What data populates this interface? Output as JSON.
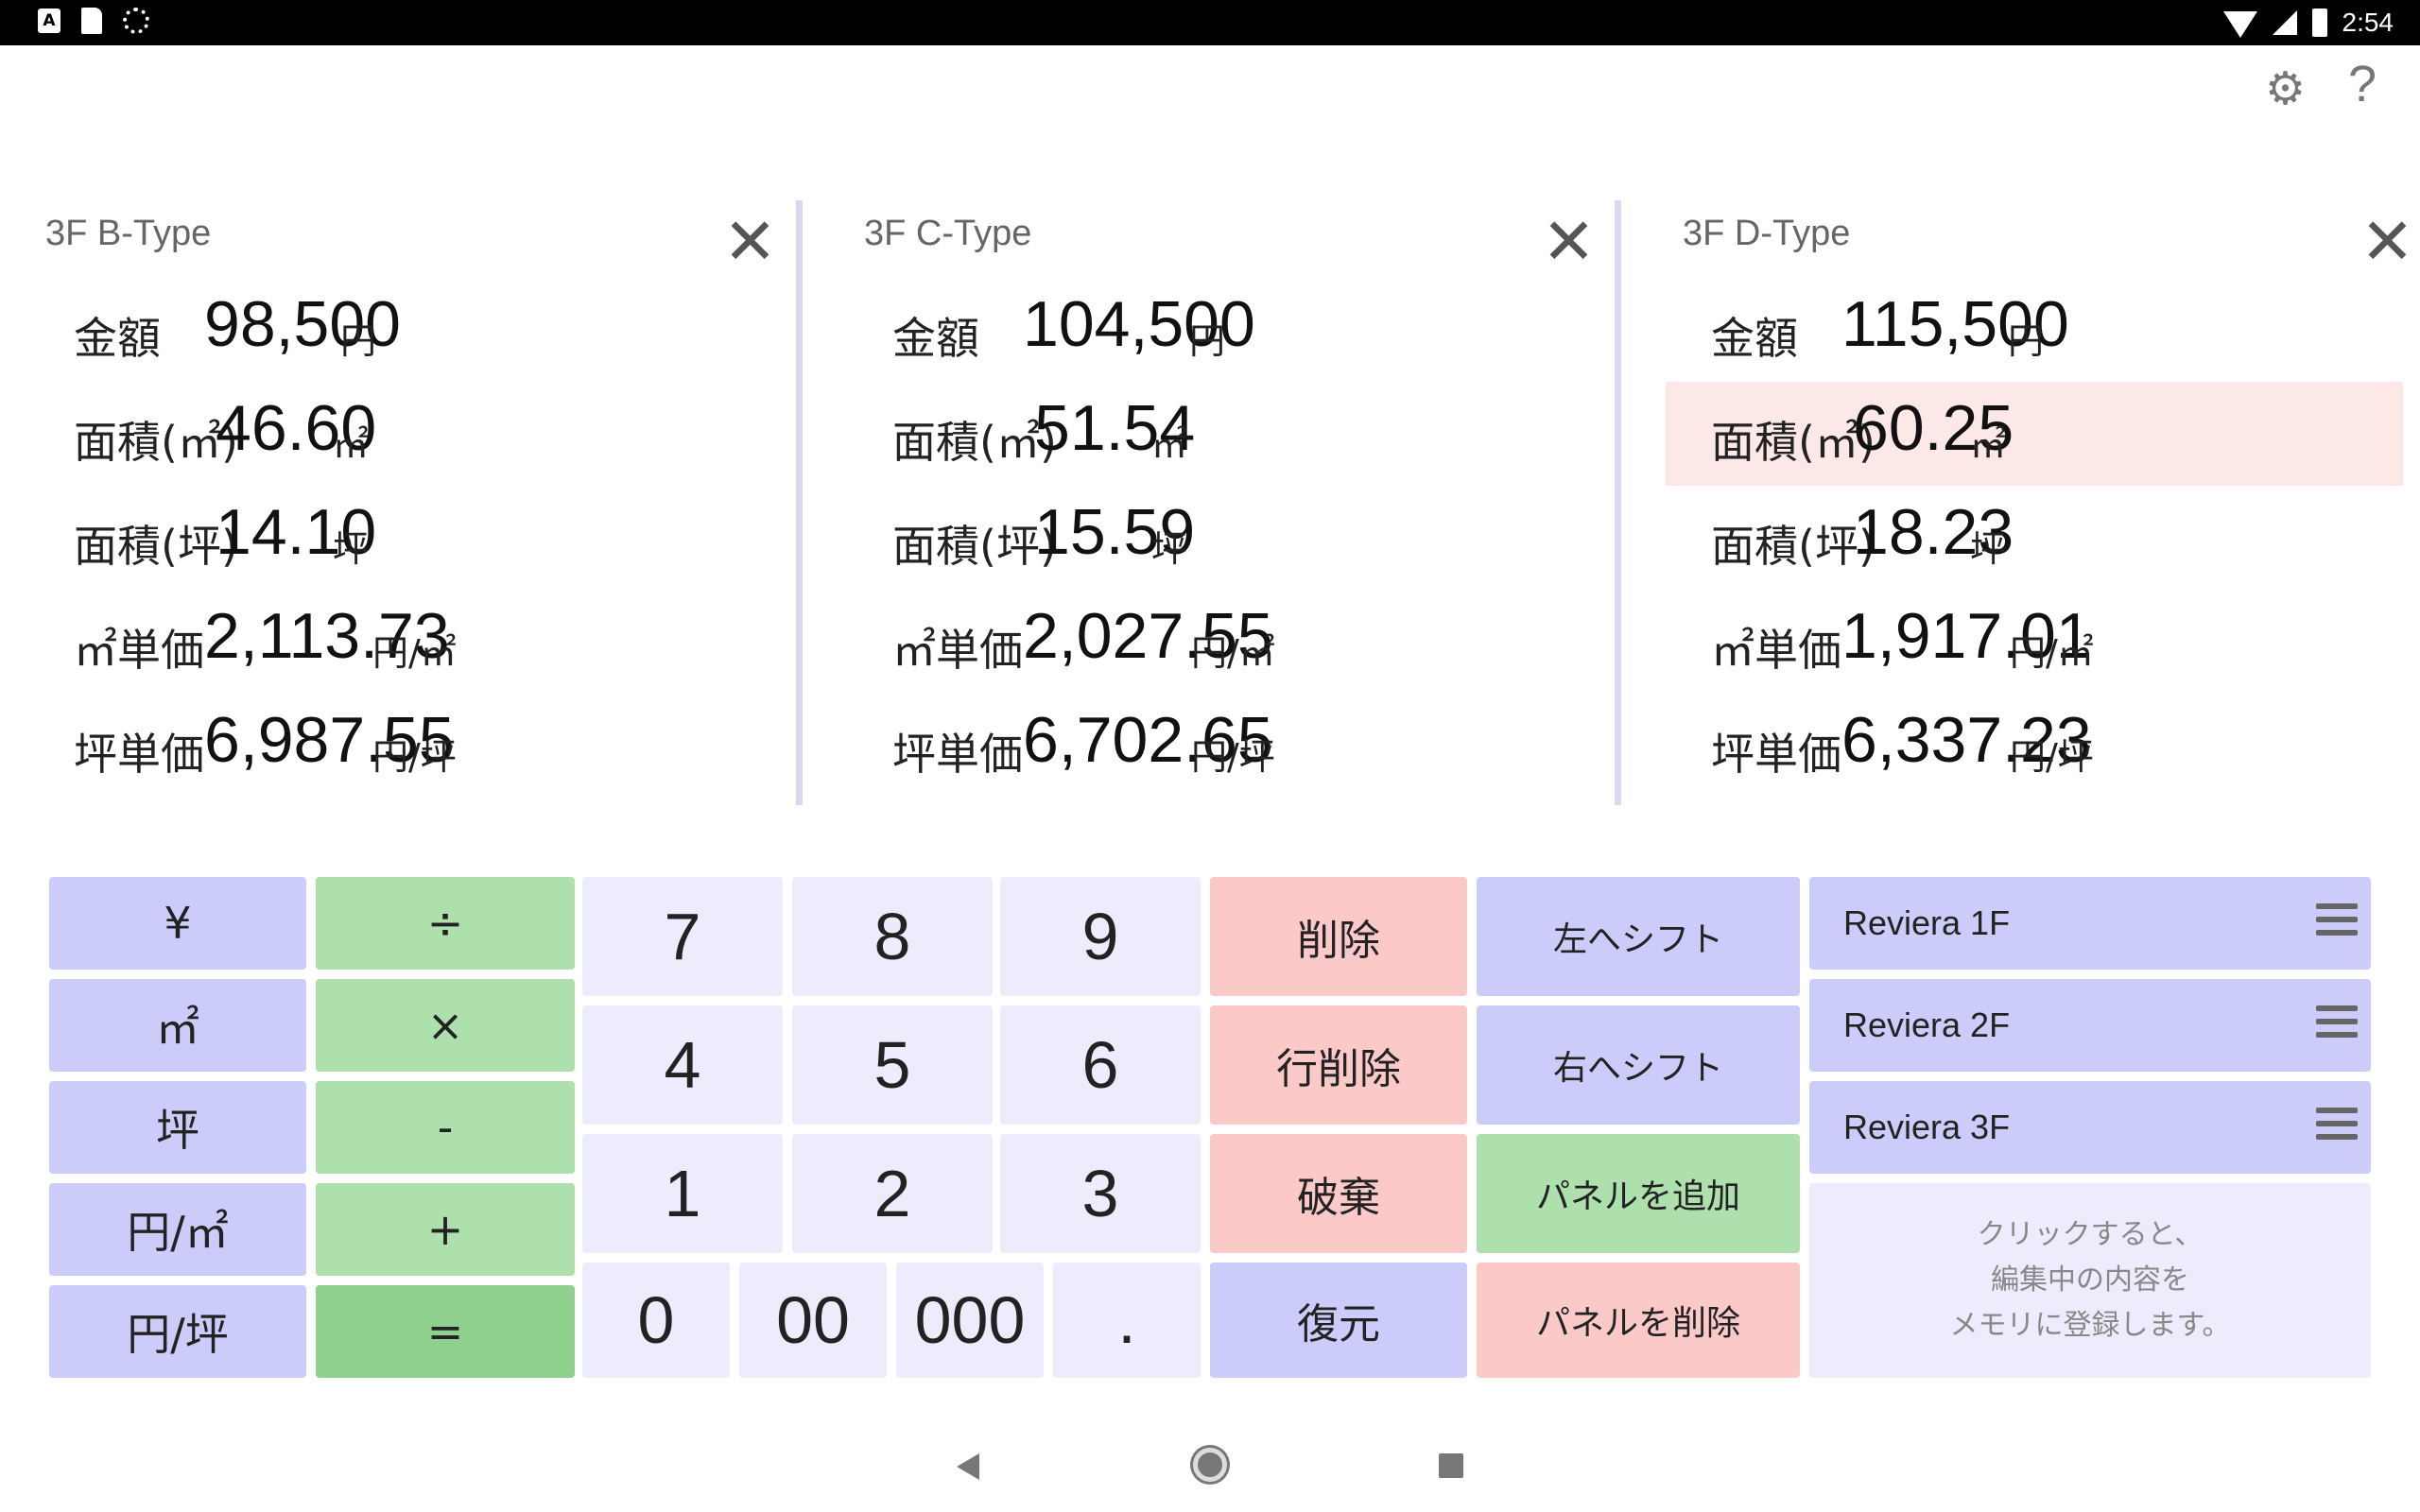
{
  "status_bar": {
    "time": "2:54",
    "notif_a": "A"
  },
  "toolbar": {
    "settings_icon": "gear-icon",
    "help_icon": "help-icon",
    "help_glyph": "?"
  },
  "panels": [
    {
      "title": "3F B-Type",
      "rows": [
        {
          "label": "金額",
          "value": "98,500",
          "unit": "円"
        },
        {
          "label": "面積(㎡)",
          "value": "46.60",
          "unit": "㎡"
        },
        {
          "label": "面積(坪)",
          "value": "14.10",
          "unit": "坪"
        },
        {
          "label": "㎡単価",
          "value": "2,113.73",
          "unit": "円/㎡"
        },
        {
          "label": "坪単価",
          "value": "6,987.55",
          "unit": "円/坪"
        }
      ]
    },
    {
      "title": "3F C-Type",
      "rows": [
        {
          "label": "金額",
          "value": "104,500",
          "unit": "円"
        },
        {
          "label": "面積(㎡)",
          "value": "51.54",
          "unit": "㎡"
        },
        {
          "label": "面積(坪)",
          "value": "15.59",
          "unit": "坪"
        },
        {
          "label": "㎡単価",
          "value": "2,027.55",
          "unit": "円/㎡"
        },
        {
          "label": "坪単価",
          "value": "6,702.65",
          "unit": "円/坪"
        }
      ]
    },
    {
      "title": "3F D-Type",
      "rows": [
        {
          "label": "金額",
          "value": "115,500",
          "unit": "円"
        },
        {
          "label": "面積(㎡)",
          "value": "60.25",
          "unit": "㎡"
        },
        {
          "label": "面積(坪)",
          "value": "18.23",
          "unit": "坪"
        },
        {
          "label": "㎡単価",
          "value": "1,917.01",
          "unit": "円/㎡"
        },
        {
          "label": "坪単価",
          "value": "6,337.23",
          "unit": "円/坪"
        }
      ]
    }
  ],
  "keypad": {
    "unit_keys": [
      "¥",
      "㎡",
      "坪",
      "円/㎡",
      "円/坪"
    ],
    "op_keys": [
      "÷",
      "×",
      "-",
      "+",
      "="
    ],
    "digits_row1": [
      "7",
      "8",
      "9"
    ],
    "digits_row2": [
      "4",
      "5",
      "6"
    ],
    "digits_row3": [
      "1",
      "2",
      "3"
    ],
    "digits_row4": [
      "0",
      "00",
      "000",
      "."
    ],
    "action_keys": [
      "削除",
      "行削除",
      "破棄",
      "復元"
    ],
    "shift_keys": [
      "左へシフト",
      "右へシフト",
      "パネルを追加",
      "パネルを削除"
    ]
  },
  "memory": {
    "items": [
      "Reviera 1F",
      "Reviera 2F",
      "Reviera 3F"
    ],
    "hint_lines": [
      "クリックすると、",
      "編集中の内容を",
      "メモリに登録します。"
    ]
  },
  "colors": {
    "unit_key": "#ccccfa",
    "op_key": "#ade0ad",
    "equals_key": "#8fd08f",
    "digit_key": "#ececfc",
    "action_key": "#fcc9c9",
    "highlight_row": "#fde8e8"
  }
}
